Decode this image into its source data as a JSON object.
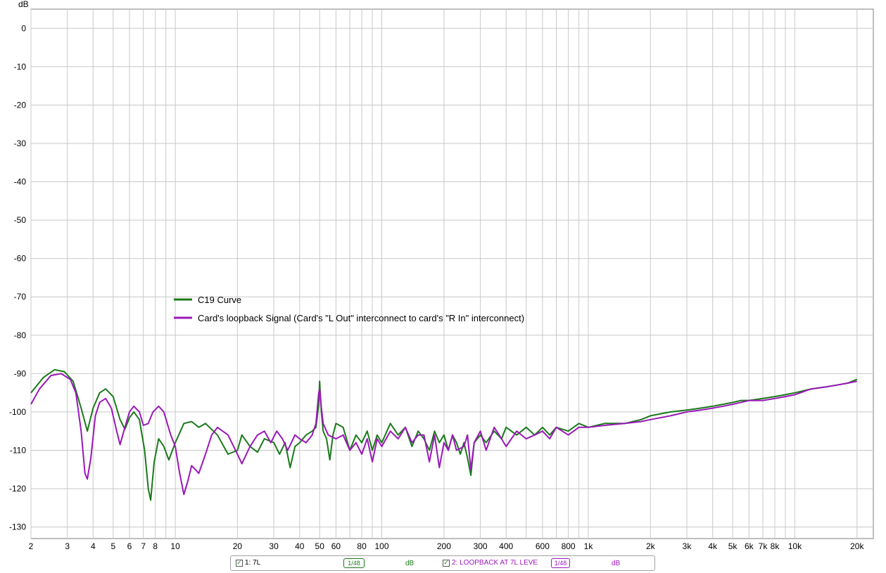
{
  "chart_data": {
    "type": "line",
    "ylabel": "dB",
    "xscale": "log",
    "xlim": [
      2,
      24000
    ],
    "ylim": [
      -133,
      5
    ],
    "y_ticks": [
      0,
      -10,
      -20,
      -30,
      -40,
      -50,
      -60,
      -70,
      -80,
      -90,
      -100,
      -110,
      -120,
      -130
    ],
    "x_ticks": [
      {
        "v": 2,
        "label": "2"
      },
      {
        "v": 3,
        "label": "3"
      },
      {
        "v": 4,
        "label": "4"
      },
      {
        "v": 5,
        "label": "5"
      },
      {
        "v": 6,
        "label": "6"
      },
      {
        "v": 7,
        "label": "7"
      },
      {
        "v": 8,
        "label": "8"
      },
      {
        "v": 10,
        "label": "10"
      },
      {
        "v": 20,
        "label": "20"
      },
      {
        "v": 30,
        "label": "30"
      },
      {
        "v": 40,
        "label": "40"
      },
      {
        "v": 50,
        "label": "50"
      },
      {
        "v": 60,
        "label": "60"
      },
      {
        "v": 80,
        "label": "80"
      },
      {
        "v": 100,
        "label": "100"
      },
      {
        "v": 200,
        "label": "200"
      },
      {
        "v": 300,
        "label": "300"
      },
      {
        "v": 400,
        "label": "400"
      },
      {
        "v": 600,
        "label": "600"
      },
      {
        "v": 800,
        "label": "800"
      },
      {
        "v": 1000,
        "label": "1k"
      },
      {
        "v": 2000,
        "label": "2k"
      },
      {
        "v": 3000,
        "label": "3k"
      },
      {
        "v": 4000,
        "label": "4k"
      },
      {
        "v": 5000,
        "label": "5k"
      },
      {
        "v": 6000,
        "label": "6k"
      },
      {
        "v": 7000,
        "label": "7k"
      },
      {
        "v": 8000,
        "label": "8k"
      },
      {
        "v": 10000,
        "label": "10k"
      },
      {
        "v": 20000,
        "label": "20k"
      }
    ],
    "grid": true,
    "legend_position": "center-left",
    "series": [
      {
        "name": "C19 Curve",
        "color": "#1a7a1a",
        "points": [
          [
            2,
            -95
          ],
          [
            2.3,
            -91
          ],
          [
            2.6,
            -89
          ],
          [
            2.9,
            -89.5
          ],
          [
            3.2,
            -92
          ],
          [
            3.5,
            -99
          ],
          [
            3.75,
            -105
          ],
          [
            4.0,
            -99
          ],
          [
            4.3,
            -95
          ],
          [
            4.6,
            -94
          ],
          [
            5.0,
            -96
          ],
          [
            5.4,
            -102
          ],
          [
            5.7,
            -104.5
          ],
          [
            6.0,
            -101.5
          ],
          [
            6.3,
            -100
          ],
          [
            6.7,
            -102
          ],
          [
            7.1,
            -110
          ],
          [
            7.4,
            -120
          ],
          [
            7.6,
            -123
          ],
          [
            7.9,
            -113
          ],
          [
            8.3,
            -107
          ],
          [
            8.8,
            -109
          ],
          [
            9.3,
            -112.5
          ],
          [
            10,
            -108
          ],
          [
            11,
            -103
          ],
          [
            12,
            -102.5
          ],
          [
            13,
            -104
          ],
          [
            14,
            -103
          ],
          [
            16,
            -106
          ],
          [
            18,
            -111
          ],
          [
            20,
            -110
          ],
          [
            21,
            -106
          ],
          [
            23,
            -109
          ],
          [
            25,
            -110.5
          ],
          [
            27,
            -107
          ],
          [
            30,
            -108
          ],
          [
            32,
            -111
          ],
          [
            34,
            -108
          ],
          [
            36,
            -114.5
          ],
          [
            38,
            -109
          ],
          [
            40,
            -108
          ],
          [
            43,
            -106
          ],
          [
            46,
            -105
          ],
          [
            48,
            -104
          ],
          [
            49.5,
            -98
          ],
          [
            50,
            -92
          ],
          [
            51,
            -100
          ],
          [
            52,
            -105
          ],
          [
            54,
            -107
          ],
          [
            56,
            -112.5
          ],
          [
            58,
            -106
          ],
          [
            60,
            -103
          ],
          [
            65,
            -104
          ],
          [
            70,
            -110
          ],
          [
            75,
            -106
          ],
          [
            80,
            -108
          ],
          [
            85,
            -105
          ],
          [
            90,
            -110
          ],
          [
            95,
            -106
          ],
          [
            100,
            -108
          ],
          [
            110,
            -103
          ],
          [
            120,
            -106
          ],
          [
            130,
            -104
          ],
          [
            140,
            -109
          ],
          [
            150,
            -105
          ],
          [
            160,
            -107
          ],
          [
            170,
            -110
          ],
          [
            180,
            -105
          ],
          [
            190,
            -108
          ],
          [
            200,
            -106
          ],
          [
            210,
            -110
          ],
          [
            220,
            -106
          ],
          [
            230,
            -108
          ],
          [
            240,
            -111
          ],
          [
            250,
            -108
          ],
          [
            260,
            -112
          ],
          [
            270,
            -116.5
          ],
          [
            280,
            -108
          ],
          [
            300,
            -106
          ],
          [
            320,
            -108
          ],
          [
            350,
            -105
          ],
          [
            380,
            -107
          ],
          [
            400,
            -104
          ],
          [
            450,
            -106
          ],
          [
            500,
            -104
          ],
          [
            550,
            -106
          ],
          [
            600,
            -104
          ],
          [
            650,
            -106
          ],
          [
            700,
            -104
          ],
          [
            800,
            -105
          ],
          [
            900,
            -103
          ],
          [
            1000,
            -104
          ],
          [
            1200,
            -103
          ],
          [
            1500,
            -103
          ],
          [
            1800,
            -102
          ],
          [
            2000,
            -101
          ],
          [
            2500,
            -100
          ],
          [
            3000,
            -99.5
          ],
          [
            3500,
            -99
          ],
          [
            4000,
            -98.5
          ],
          [
            4500,
            -98
          ],
          [
            5000,
            -97.5
          ],
          [
            5500,
            -97
          ],
          [
            6000,
            -97
          ],
          [
            7000,
            -96.5
          ],
          [
            8000,
            -96
          ],
          [
            9000,
            -95.5
          ],
          [
            10000,
            -95
          ],
          [
            12000,
            -94
          ],
          [
            14000,
            -93.5
          ],
          [
            16000,
            -93
          ],
          [
            18000,
            -92.5
          ],
          [
            20000,
            -91.5
          ]
        ]
      },
      {
        "name": "Card's loopback Signal (Card's \"L Out\" interconnect to card's \"R In\" interconnect)",
        "color": "#9a18b8",
        "points": [
          [
            2,
            -98
          ],
          [
            2.2,
            -94
          ],
          [
            2.5,
            -90.5
          ],
          [
            2.8,
            -90
          ],
          [
            3.1,
            -91.5
          ],
          [
            3.3,
            -95
          ],
          [
            3.5,
            -105
          ],
          [
            3.65,
            -116
          ],
          [
            3.75,
            -117.5
          ],
          [
            3.9,
            -112
          ],
          [
            4.1,
            -101
          ],
          [
            4.3,
            -97.5
          ],
          [
            4.6,
            -96.5
          ],
          [
            4.9,
            -99
          ],
          [
            5.2,
            -105
          ],
          [
            5.4,
            -108.5
          ],
          [
            5.7,
            -104
          ],
          [
            6.0,
            -100
          ],
          [
            6.3,
            -98.5
          ],
          [
            6.7,
            -100
          ],
          [
            7.0,
            -103.5
          ],
          [
            7.4,
            -103
          ],
          [
            7.8,
            -100
          ],
          [
            8.3,
            -98.5
          ],
          [
            8.8,
            -100
          ],
          [
            9.5,
            -106
          ],
          [
            10,
            -109
          ],
          [
            10.5,
            -116
          ],
          [
            11,
            -121.5
          ],
          [
            11.5,
            -118
          ],
          [
            12,
            -114
          ],
          [
            13,
            -116
          ],
          [
            14,
            -111
          ],
          [
            15,
            -106
          ],
          [
            16,
            -104
          ],
          [
            18,
            -106
          ],
          [
            20,
            -111
          ],
          [
            21,
            -113.5
          ],
          [
            23,
            -109
          ],
          [
            25,
            -106
          ],
          [
            27,
            -105
          ],
          [
            29,
            -108
          ],
          [
            31,
            -105
          ],
          [
            33,
            -107
          ],
          [
            35,
            -110
          ],
          [
            38,
            -106
          ],
          [
            40,
            -107
          ],
          [
            43,
            -108
          ],
          [
            46,
            -106
          ],
          [
            48,
            -103
          ],
          [
            49.5,
            -95
          ],
          [
            50,
            -94
          ],
          [
            51,
            -99
          ],
          [
            52,
            -103
          ],
          [
            55,
            -106
          ],
          [
            60,
            -107
          ],
          [
            65,
            -106
          ],
          [
            70,
            -110
          ],
          [
            75,
            -108
          ],
          [
            80,
            -111
          ],
          [
            85,
            -107
          ],
          [
            90,
            -113
          ],
          [
            95,
            -107
          ],
          [
            100,
            -109
          ],
          [
            110,
            -105
          ],
          [
            120,
            -107
          ],
          [
            130,
            -104
          ],
          [
            140,
            -108
          ],
          [
            150,
            -106
          ],
          [
            160,
            -106
          ],
          [
            170,
            -113
          ],
          [
            180,
            -106
          ],
          [
            190,
            -114.5
          ],
          [
            200,
            -108
          ],
          [
            210,
            -110
          ],
          [
            220,
            -106
          ],
          [
            230,
            -110
          ],
          [
            250,
            -109
          ],
          [
            260,
            -106
          ],
          [
            270,
            -115
          ],
          [
            280,
            -108
          ],
          [
            300,
            -105
          ],
          [
            320,
            -110
          ],
          [
            350,
            -104
          ],
          [
            380,
            -107
          ],
          [
            400,
            -109
          ],
          [
            450,
            -105
          ],
          [
            500,
            -107
          ],
          [
            550,
            -106
          ],
          [
            600,
            -105
          ],
          [
            650,
            -107
          ],
          [
            700,
            -104
          ],
          [
            800,
            -106
          ],
          [
            900,
            -104
          ],
          [
            1000,
            -104
          ],
          [
            1200,
            -103.5
          ],
          [
            1500,
            -103
          ],
          [
            1800,
            -102.5
          ],
          [
            2000,
            -102
          ],
          [
            2500,
            -101
          ],
          [
            3000,
            -100
          ],
          [
            3500,
            -99.5
          ],
          [
            4000,
            -99
          ],
          [
            4500,
            -98.5
          ],
          [
            5000,
            -98
          ],
          [
            5500,
            -97.5
          ],
          [
            6000,
            -97
          ],
          [
            7000,
            -97
          ],
          [
            8000,
            -96.5
          ],
          [
            9000,
            -96
          ],
          [
            10000,
            -95.5
          ],
          [
            12000,
            -94
          ],
          [
            14000,
            -93.5
          ],
          [
            16000,
            -93
          ],
          [
            18000,
            -92.5
          ],
          [
            20000,
            -92
          ]
        ]
      }
    ]
  },
  "statusbar": {
    "item1_label": "1: 7L",
    "item1_smoothing": "1/48",
    "item1_unit": "dB",
    "item2_label": "2: LOOPBACK AT 7L LEVE",
    "item2_smoothing": "1/48",
    "item2_unit": "dB",
    "checkmark": "✓"
  }
}
